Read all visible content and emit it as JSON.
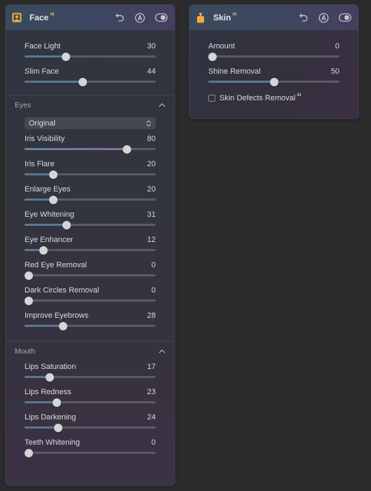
{
  "colors": {
    "background": "#2b2b2b",
    "accent_fill": "#5a7892",
    "ai_badge": "#f2c266",
    "face_icon": "#f2b43c",
    "skin_icon": "#f2aa3e"
  },
  "face_panel": {
    "title": "Face",
    "badge": "AI",
    "title_icon": "portrait-icon",
    "header_icons": [
      "undo-icon",
      "auto-icon",
      "toggle-icon"
    ],
    "sliders": [
      {
        "label": "Face Light",
        "value": "30",
        "fraction": 0.3
      },
      {
        "label": "Slim Face",
        "value": "44",
        "fraction": 0.44
      }
    ],
    "eyes": {
      "label": "Eyes",
      "expanded": true,
      "select_value": "Original",
      "sliders": [
        {
          "label": "Iris Visibility",
          "value": "80",
          "fraction": 0.8,
          "gradient": true
        },
        {
          "label": "Iris Flare",
          "value": "20",
          "fraction": 0.2
        },
        {
          "label": "Enlarge Eyes",
          "value": "20",
          "fraction": 0.2
        },
        {
          "label": "Eye Whitening",
          "value": "31",
          "fraction": 0.31
        },
        {
          "label": "Eye Enhancer",
          "value": "12",
          "fraction": 0.12
        },
        {
          "label": "Red Eye Removal",
          "value": "0",
          "fraction": 0.0
        },
        {
          "label": "Dark Circles Removal",
          "value": "0",
          "fraction": 0.0
        },
        {
          "label": "Improve Eyebrows",
          "value": "28",
          "fraction": 0.28
        }
      ]
    },
    "mouth": {
      "label": "Mouth",
      "expanded": true,
      "sliders": [
        {
          "label": "Lips Saturation",
          "value": "17",
          "fraction": 0.17
        },
        {
          "label": "Lips Redness",
          "value": "23",
          "fraction": 0.23
        },
        {
          "label": "Lips Darkening",
          "value": "24",
          "fraction": 0.24
        },
        {
          "label": "Teeth Whitening",
          "value": "0",
          "fraction": 0.0
        }
      ]
    }
  },
  "skin_panel": {
    "title": "Skin",
    "badge": "AI",
    "title_icon": "bottle-icon",
    "header_icons": [
      "undo-icon",
      "auto-icon",
      "toggle-icon"
    ],
    "sliders": [
      {
        "label": "Amount",
        "value": "0",
        "fraction": 0.0
      },
      {
        "label": "Shine Removal",
        "value": "50",
        "fraction": 0.5
      }
    ],
    "checkbox": {
      "label": "Skin Defects Removal",
      "badge": "AI",
      "checked": false
    }
  }
}
